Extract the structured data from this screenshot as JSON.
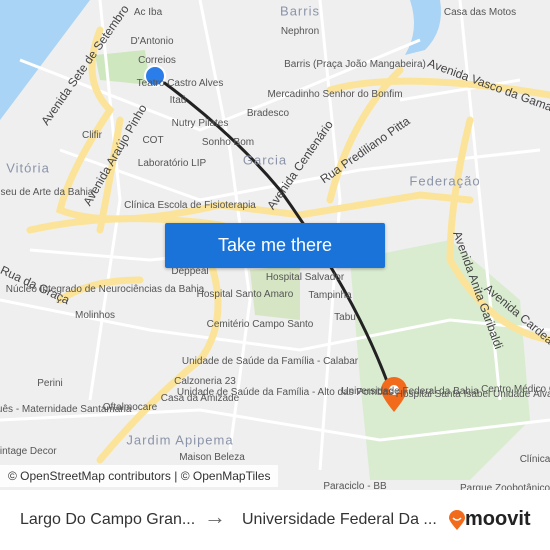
{
  "map": {
    "labels": {
      "areas": [
        "Barris",
        "Vitória",
        "Garcia",
        "Federação",
        "Jardim Apipema"
      ],
      "streets": [
        "Avenida Sete de Setembro",
        "Avenida Araújo Pinho",
        "Avenida Centenário",
        "Rua Prediliano Pitta",
        "Avenida Vasco da Gama",
        "Avenida Anita Garibaldi",
        "Avenida Cardeal",
        "Rua da Graça"
      ],
      "places": [
        "Ac Iba",
        "D'Antonio",
        "Correios",
        "Teatro Castro Alves",
        "Itaú",
        "Nutry Pilates",
        "Sonho Bom",
        "Clifir",
        "COT",
        "Laboratório LIP",
        "Museu de Arte da Bahia",
        "Clínica Escola de Fisioterapia",
        "Nephron",
        "Barris (Praça João Mangabeira)",
        "Mercadinho Senhor do Bonfim",
        "Bradesco",
        "Casa das Motos",
        "Deppeal",
        "Núcleo Integrado de Neurociências da Bahia",
        "Molinhos",
        "Hospital Salvador",
        "Tampinha",
        "Hospital Santo Amaro",
        "Cemitério Campo Santo",
        "Unidade de Saúde da Família - Calabar",
        "Unidade de Saúde da Família - Alto das Pombas",
        "Calzoneria 23",
        "Casa da Amizade",
        "Oftalmocare",
        "Perini",
        "Hospital Português - Maternidade Santamaria",
        "Maison Beleza",
        "Universidade Federal da Bahia",
        "Hospital Santa Isabel Unidade Álvaro Lemos",
        "Centro Médico Garibaldi",
        "Clínica",
        "Paraciclo - BB",
        "Parque Zoobotânico",
        "Tabu",
        "Vintage Decor"
      ]
    },
    "origin_marker_color": "#2b7de9",
    "destination_marker_color": "#f26a1b",
    "route_color": "#222222",
    "water_color": "#a9d4f5",
    "major_road_color": "#fbe49a",
    "park_color": "#cfe7bf"
  },
  "cta": {
    "label": "Take me there"
  },
  "attribution": "© OpenStreetMap contributors | © OpenMapTiles",
  "footer": {
    "from": "Largo Do Campo Gran...",
    "arrow": "→",
    "to": "Universidade Federal Da ...",
    "brand": "moovit"
  }
}
